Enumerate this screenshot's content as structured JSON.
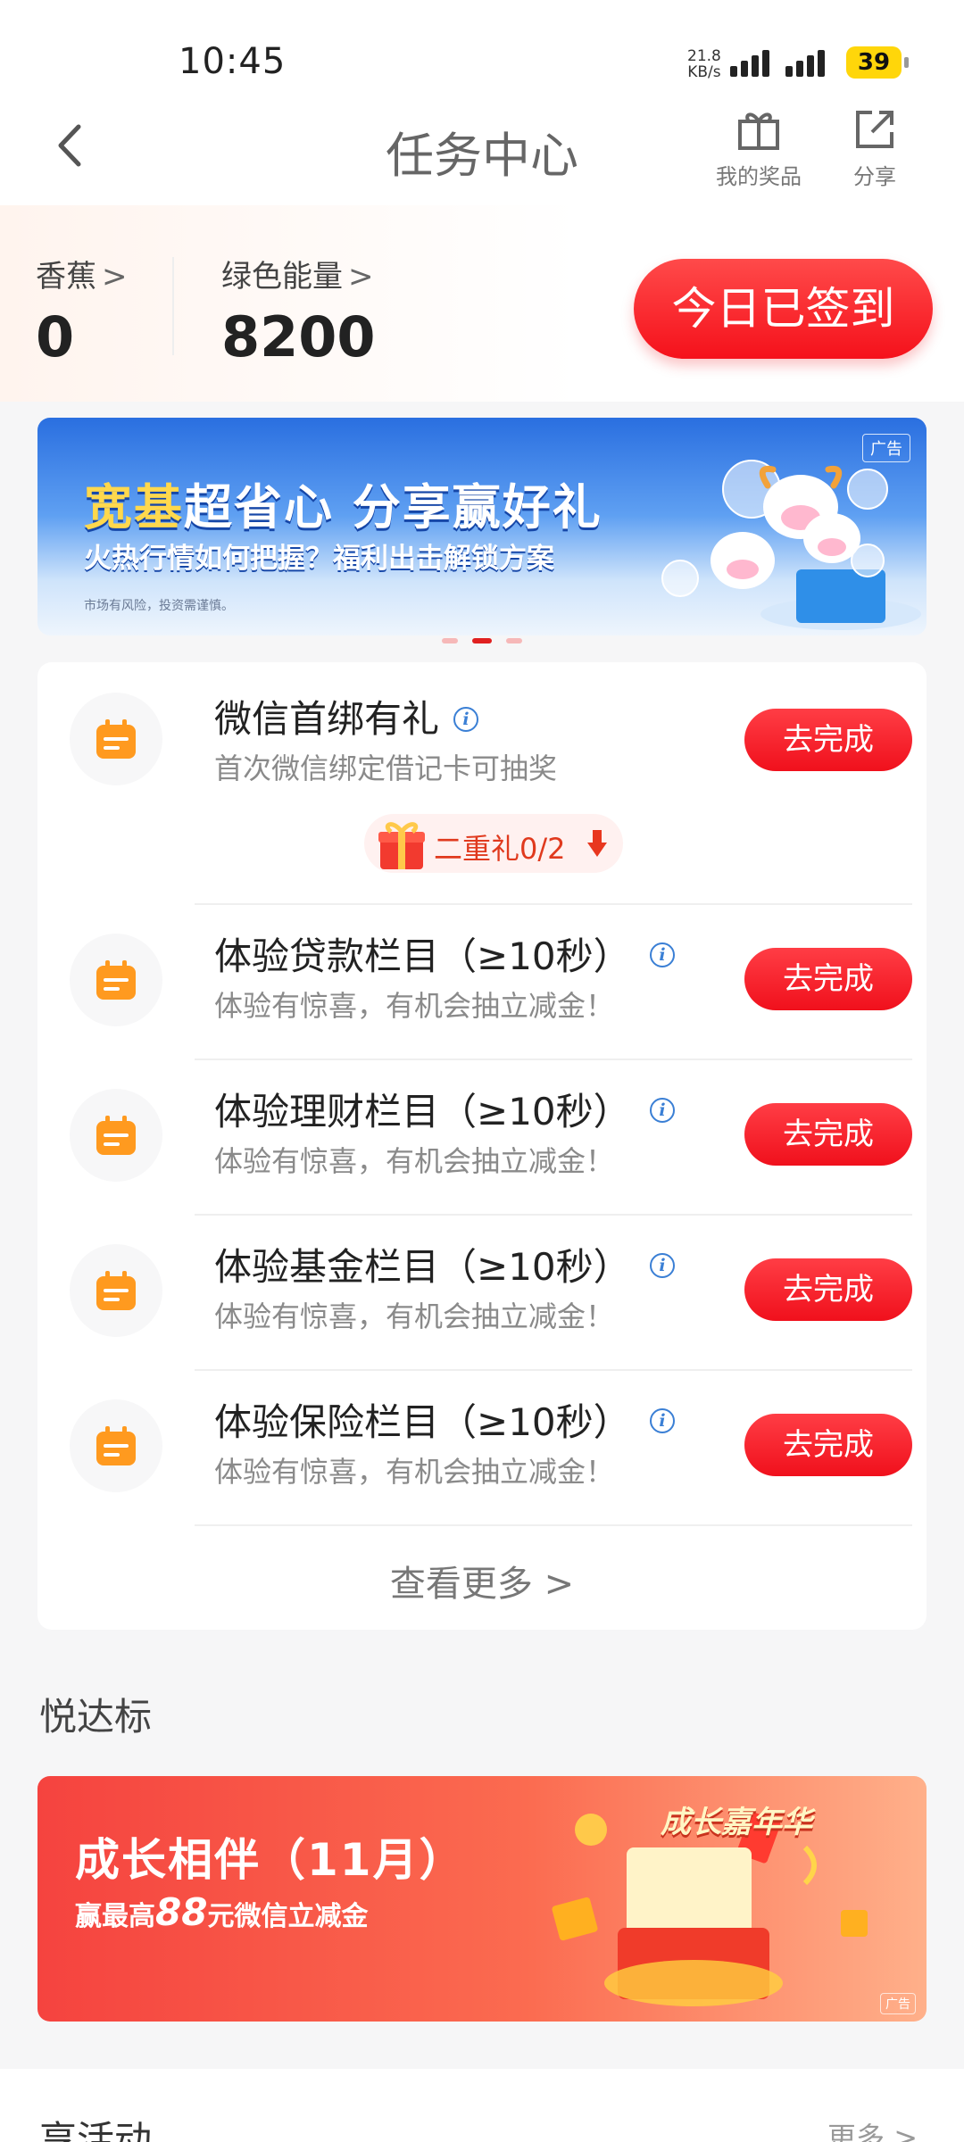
{
  "status": {
    "time": "10:45",
    "net_speed_value": "21.8",
    "net_speed_unit": "KB/s",
    "battery": "39"
  },
  "nav": {
    "title": "任务中心",
    "prizes_label": "我的奖品",
    "share_label": "分享"
  },
  "stats": {
    "banana_label": "香蕉",
    "banana_value": "0",
    "energy_label": "绿色能量",
    "energy_value": "8200",
    "checkin_label": "今日已签到"
  },
  "banner": {
    "ad_tag": "广告",
    "headline_highlight": "宽基",
    "headline_rest": "超省心 分享赢好礼",
    "subline": "火热行情如何把握？福利出击解锁方案",
    "disclaimer": "市场有风险，投资需谨慎。",
    "page_count": 3,
    "active_page": 2
  },
  "tasks": [
    {
      "title": "微信首绑有礼",
      "desc": "首次微信绑定借记卡可抽奖",
      "button": "去完成"
    },
    {
      "title": "体验贷款栏目（≥10秒）",
      "desc": "体验有惊喜，有机会抽立减金！",
      "button": "去完成"
    },
    {
      "title": "体验理财栏目（≥10秒）",
      "desc": "体验有惊喜，有机会抽立减金！",
      "button": "去完成"
    },
    {
      "title": "体验基金栏目（≥10秒）",
      "desc": "体验有惊喜，有机会抽立减金！",
      "button": "去完成"
    },
    {
      "title": "体验保险栏目（≥10秒）",
      "desc": "体验有惊喜，有机会抽立减金！",
      "button": "去完成"
    }
  ],
  "bonus": {
    "label": "二重礼0/2"
  },
  "see_more": "查看更多",
  "section_yuedabiao": {
    "title": "悦达标",
    "promo_title": "成长相伴（11月）",
    "promo_sub_prefix": "赢最高",
    "promo_sub_amount": "88",
    "promo_sub_suffix": "元微信立减金",
    "promo_badge": "成长嘉年华",
    "promo_ad_tag": "广告"
  },
  "section_activity": {
    "title": "享活动",
    "more": "更多"
  },
  "colors": {
    "primary_red": "#f5111b",
    "task_icon": "#ff9a1f",
    "info_blue": "#3a7fd5"
  }
}
